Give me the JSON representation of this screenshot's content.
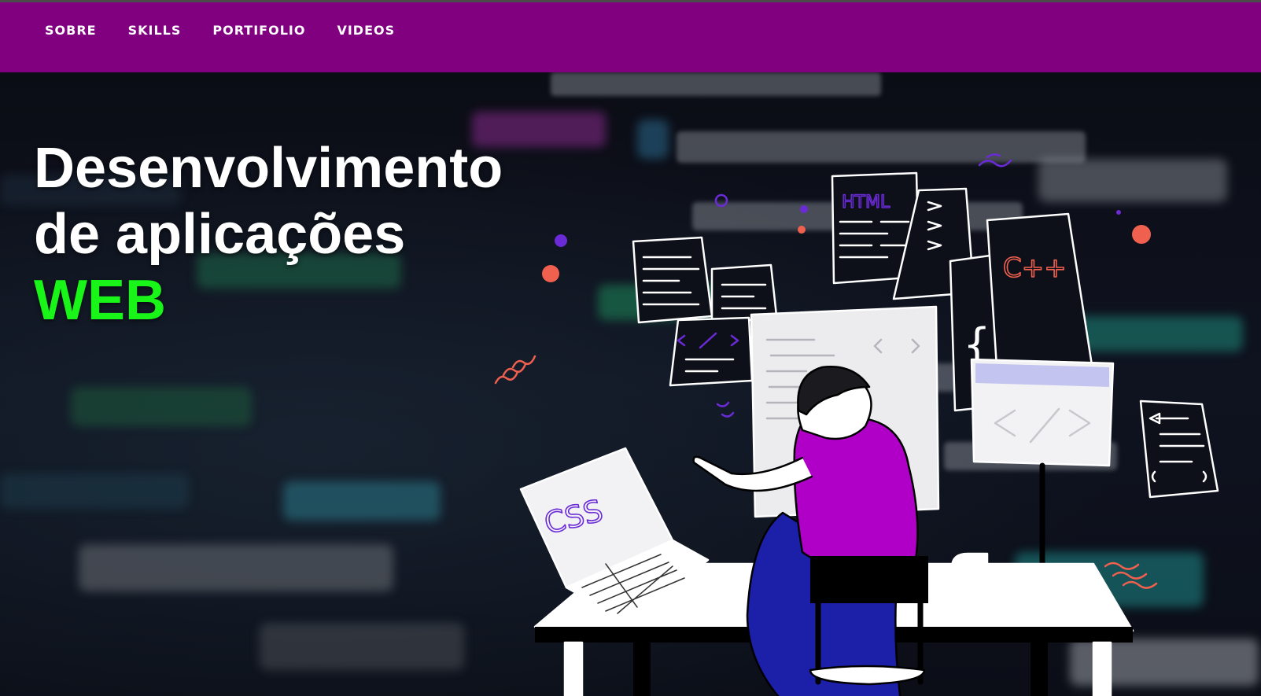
{
  "nav": {
    "items": [
      {
        "label": "SOBRE"
      },
      {
        "label": "SKILLS"
      },
      {
        "label": "PORTIFOLIO"
      },
      {
        "label": "VIDEOS"
      }
    ]
  },
  "hero": {
    "line1": "Desenvolvimento",
    "line2": "de aplicações",
    "line3": "WEB",
    "illustration": {
      "html_label": "HTML",
      "cpp_label": "C++",
      "css_label": "CSS"
    }
  },
  "colors": {
    "navbar": "#800080",
    "accent_green": "#19f519",
    "person_shirt": "#b000c8",
    "person_pants": "#1c1fa8"
  },
  "icons": [
    "code-tag-icon",
    "coffee-mug-icon",
    "laptop-icon",
    "monitor-icon"
  ]
}
